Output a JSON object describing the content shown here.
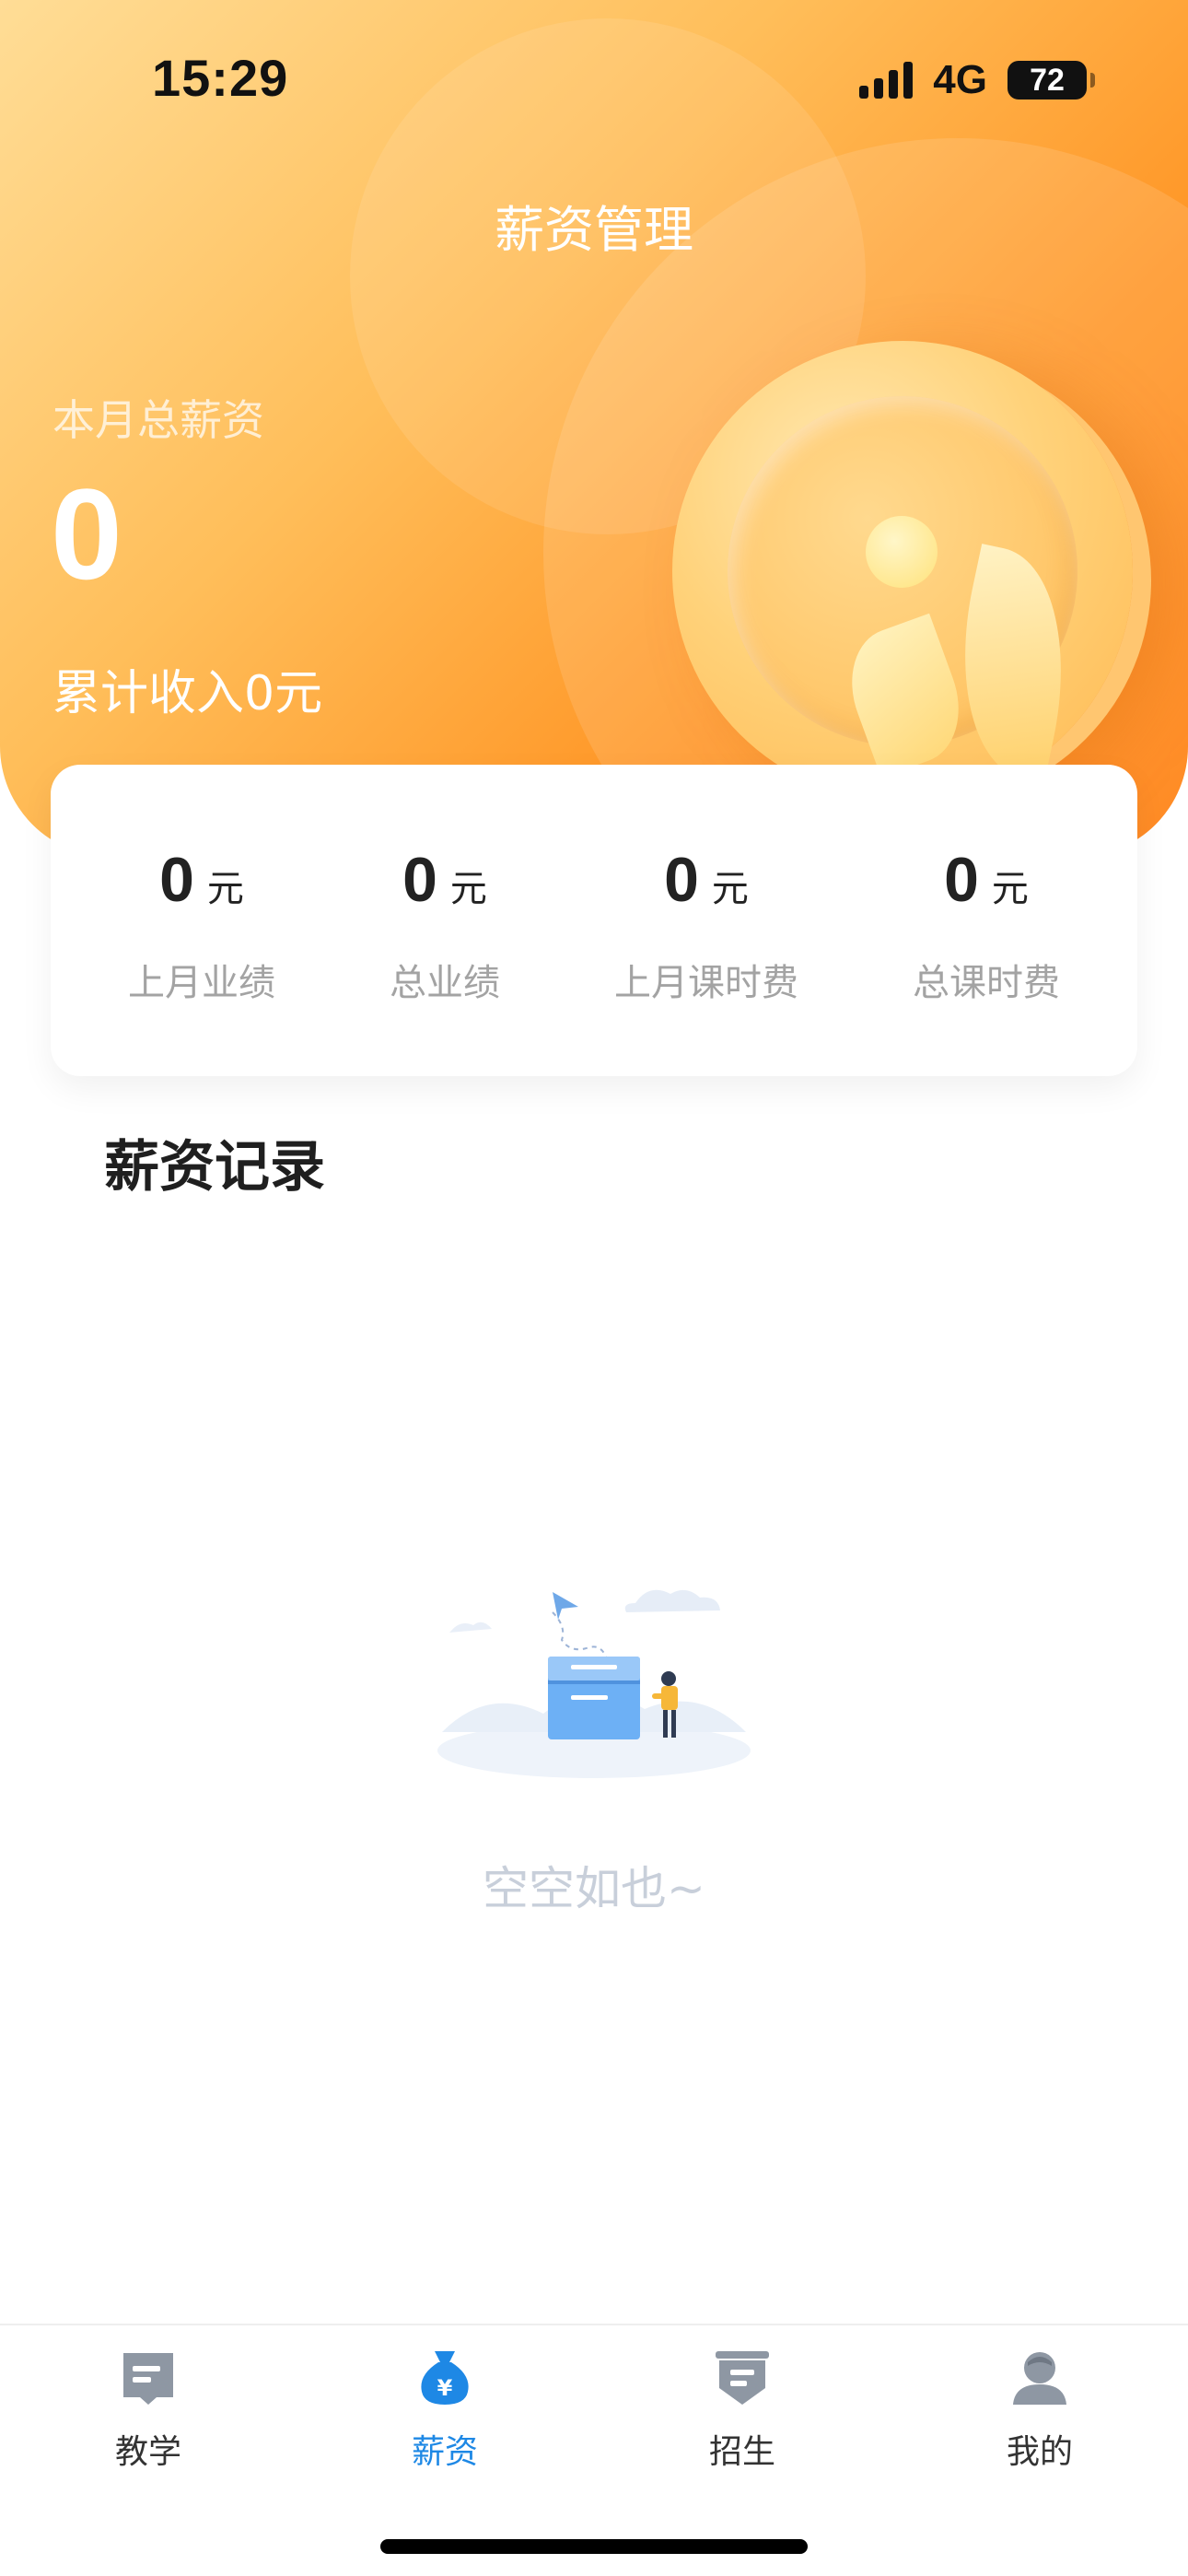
{
  "status_bar": {
    "time": "15:29",
    "network": "4G",
    "battery": "72"
  },
  "header": {
    "title": "薪资管理",
    "salary_label": "本月总薪资",
    "salary_value": "0",
    "income_text": "累计收入0元"
  },
  "stats": [
    {
      "value": "0",
      "unit": "元",
      "label": "上月业绩"
    },
    {
      "value": "0",
      "unit": "元",
      "label": "总业绩"
    },
    {
      "value": "0",
      "unit": "元",
      "label": "上月课时费"
    },
    {
      "value": "0",
      "unit": "元",
      "label": "总课时费"
    }
  ],
  "records": {
    "title": "薪资记录",
    "empty_text": "空空如也~"
  },
  "tabbar": {
    "items": [
      {
        "label": "教学",
        "icon": "teaching-icon",
        "active": false
      },
      {
        "label": "薪资",
        "icon": "money-bag-icon",
        "active": true
      },
      {
        "label": "招生",
        "icon": "enrollment-icon",
        "active": false
      },
      {
        "label": "我的",
        "icon": "profile-icon",
        "active": false
      }
    ],
    "active_color": "#1E88E5",
    "inactive_icon_color": "#8E97A3"
  },
  "colors": {
    "header_gradient_start": "#FFDD96",
    "header_gradient_end": "#FF7A05"
  }
}
